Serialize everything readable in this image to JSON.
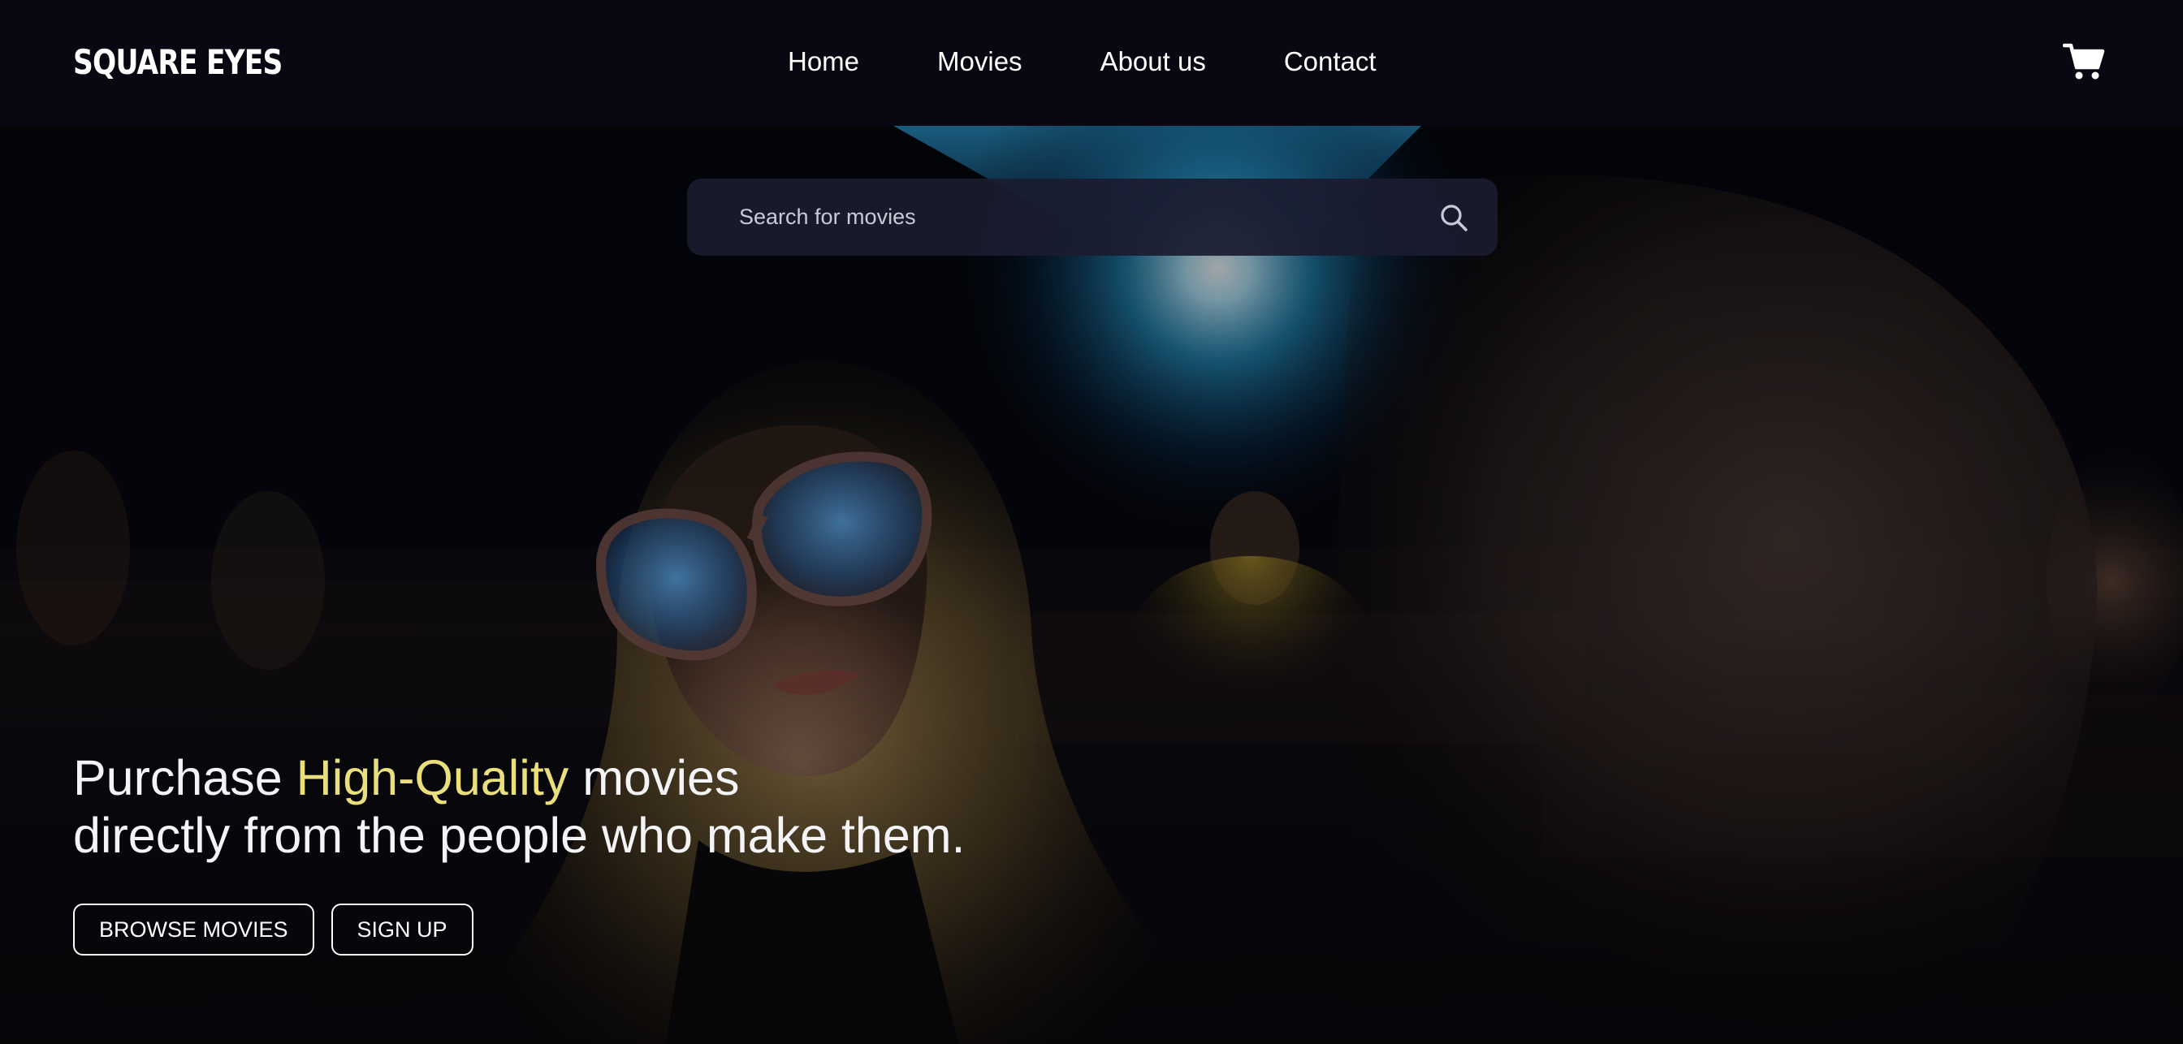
{
  "header": {
    "logo": "SQUARE EYES",
    "nav": [
      {
        "label": "Home"
      },
      {
        "label": "Movies"
      },
      {
        "label": "About us"
      },
      {
        "label": "Contact"
      }
    ],
    "cart_icon": "shopping-cart-icon"
  },
  "search": {
    "placeholder": "Search for movies",
    "icon": "search-icon"
  },
  "hero": {
    "headline_line1_part1": "Purchase ",
    "headline_line1_accent": "High-Quality",
    "headline_line1_part2": " movies",
    "headline_line2": "directly from the people who make them.",
    "buttons": {
      "browse": "BROWSE MOVIES",
      "signup": "SIGN UP"
    }
  },
  "colors": {
    "background": "#06070f",
    "accent": "#e9df7d",
    "text": "#ffffff"
  }
}
